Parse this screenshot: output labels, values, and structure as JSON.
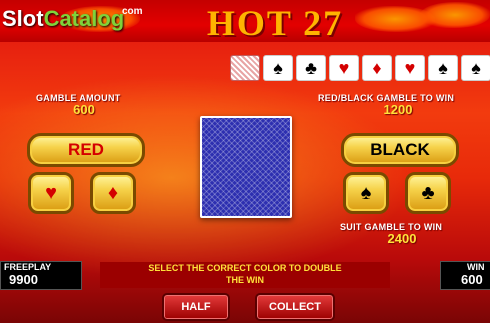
{
  "header": {
    "logo_slot": "Slot",
    "logo_catalog": "Catalog",
    "logo_com": "com",
    "title": "HOT 27"
  },
  "history": {
    "cards": [
      {
        "type": "back",
        "symbol": ""
      },
      {
        "type": "spade",
        "symbol": "♠",
        "color": "black"
      },
      {
        "type": "club",
        "symbol": "♣",
        "color": "black"
      },
      {
        "type": "heart",
        "symbol": "♥",
        "color": "red"
      },
      {
        "type": "diamond",
        "symbol": "♦",
        "color": "red"
      },
      {
        "type": "heart",
        "symbol": "♥",
        "color": "red"
      },
      {
        "type": "spade",
        "symbol": "♠",
        "color": "black"
      },
      {
        "type": "spade",
        "symbol": "♠",
        "color": "black"
      }
    ]
  },
  "gamble": {
    "amount_label": "GAMBLE AMOUNT",
    "amount_value": "600",
    "red_black_label": "RED/BLACK GAMBLE TO WIN",
    "red_black_value": "1200",
    "suit_label": "SUIT GAMBLE TO WIN",
    "suit_value": "2400"
  },
  "buttons": {
    "red": "RED",
    "black": "BLACK",
    "heart": "♥",
    "diamond": "♦",
    "spade": "♠",
    "club": "♣",
    "half": "HALF",
    "collect": "COLLECT"
  },
  "footer": {
    "freeplay_label": "FREEPLAY",
    "freeplay_value": "9900",
    "win_label": "WIN",
    "win_value": "600",
    "message_line1": "SELECT THE CORRECT COLOR TO DOUBLE",
    "message_line2": "THE WIN"
  },
  "colors": {
    "red_suit": "#d40000",
    "gold": "#ffe23a",
    "background": "#e82a0a"
  }
}
